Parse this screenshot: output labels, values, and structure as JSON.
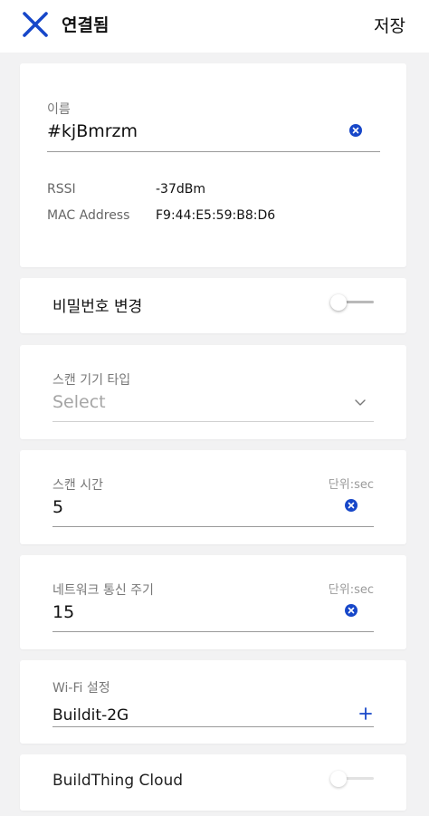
{
  "header": {
    "title": "연결됨",
    "save_label": "저장",
    "close_icon": "close-icon",
    "accent_color": "#1747c9"
  },
  "name_card": {
    "name_label": "이름",
    "name_value": "#kjBmrzm",
    "rssi_label": "RSSI",
    "rssi_value": "-37dBm",
    "mac_label": "MAC Address",
    "mac_value": "F9:44:E5:59:B8:D6"
  },
  "password_card": {
    "label": "비밀번호 변경",
    "enabled": false
  },
  "scan_type_card": {
    "label": "스캔 기기 타입",
    "placeholder": "Select"
  },
  "scan_time_card": {
    "label": "스캔 시간",
    "unit": "단위:sec",
    "value": "5"
  },
  "network_card": {
    "label": "네트워크 통신 주기",
    "unit": "단위:sec",
    "value": "15"
  },
  "wifi_card": {
    "label": "Wi-Fi 설정",
    "value": "Buildit-2G"
  },
  "cloud_card": {
    "label": "BuildThing Cloud",
    "enabled": false
  }
}
